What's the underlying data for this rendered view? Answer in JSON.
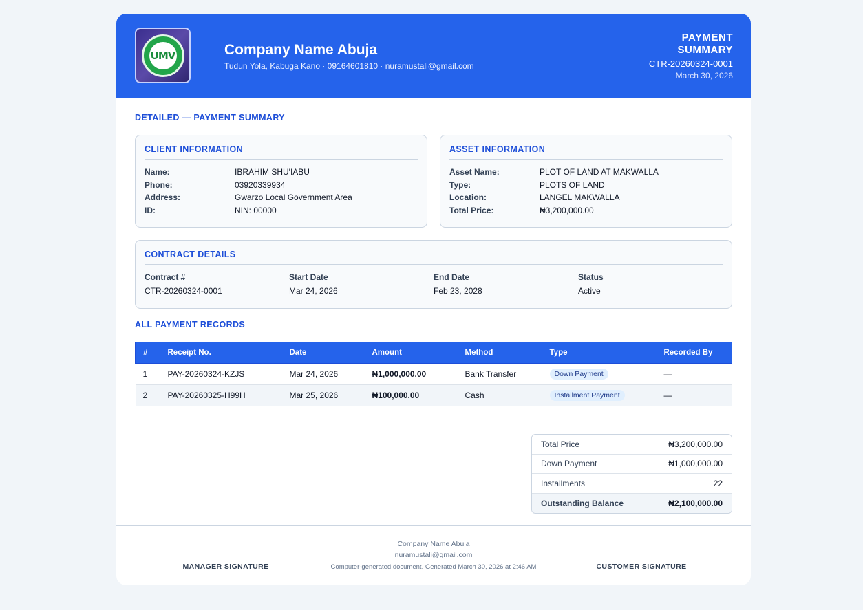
{
  "header": {
    "company_name": "Company Name Abuja",
    "company_details": "Tudun Yola, Kabuga Kano · 09164601810 · nuramustali@gmail.com",
    "doc_title": "PAYMENT SUMMARY",
    "doc_number": "CTR-20260324-0001",
    "doc_date": "March 30, 2026",
    "logo_text": "UMV"
  },
  "main_title": "DETAILED — PAYMENT SUMMARY",
  "client": {
    "title": "CLIENT INFORMATION",
    "rows": [
      {
        "label": "Name:",
        "value": "IBRAHIM SHU'IABU"
      },
      {
        "label": "Phone:",
        "value": "03920339934"
      },
      {
        "label": "Address:",
        "value": "Gwarzo Local Government Area"
      },
      {
        "label": "ID:",
        "value": "NIN: 00000"
      }
    ]
  },
  "asset": {
    "title": "ASSET INFORMATION",
    "rows": [
      {
        "label": "Asset Name:",
        "value": "PLOT OF LAND AT MAKWALLA"
      },
      {
        "label": "Type:",
        "value": "PLOTS OF LAND"
      },
      {
        "label": "Location:",
        "value": "LANGEL MAKWALLA"
      },
      {
        "label": "Total Price:",
        "value": "₦3,200,000.00"
      }
    ]
  },
  "contract": {
    "title": "CONTRACT DETAILS",
    "columns": [
      {
        "label": "Contract #",
        "value": "CTR-20260324-0001"
      },
      {
        "label": "Start Date",
        "value": "Mar 24, 2026"
      },
      {
        "label": "End Date",
        "value": "Feb 23, 2028"
      },
      {
        "label": "Status",
        "value": "Active"
      }
    ]
  },
  "records": {
    "title": "ALL PAYMENT RECORDS",
    "headers": [
      "#",
      "Receipt No.",
      "Date",
      "Amount",
      "Method",
      "Type",
      "Recorded By"
    ],
    "rows": [
      {
        "num": "1",
        "receipt": "PAY-20260324-KZJS",
        "date": "Mar 24, 2026",
        "amount": "₦1,000,000.00",
        "method": "Bank Transfer",
        "type": "Down Payment",
        "recorded_by": "—"
      },
      {
        "num": "2",
        "receipt": "PAY-20260325-H99H",
        "date": "Mar 25, 2026",
        "amount": "₦100,000.00",
        "method": "Cash",
        "type": "Installment Payment",
        "recorded_by": "—"
      }
    ]
  },
  "totals": [
    {
      "label": "Total Price",
      "value": "₦3,200,000.00"
    },
    {
      "label": "Down Payment",
      "value": "₦1,000,000.00"
    },
    {
      "label": "Installments",
      "value": "22"
    },
    {
      "label": "Outstanding Balance",
      "value": "₦2,100,000.00"
    }
  ],
  "footer": {
    "manager_signature": "MANAGER SIGNATURE",
    "customer_signature": "CUSTOMER SIGNATURE",
    "company_name": "Company Name Abuja",
    "email": "nuramustali@gmail.com",
    "generated": "Computer-generated document. Generated March 30, 2026 at 2:46 AM"
  },
  "colors": {
    "primary": "#2563eb",
    "accent_text": "#1d4ed8",
    "badge_bg": "#e0effe",
    "seal_green": "#22a54a"
  }
}
